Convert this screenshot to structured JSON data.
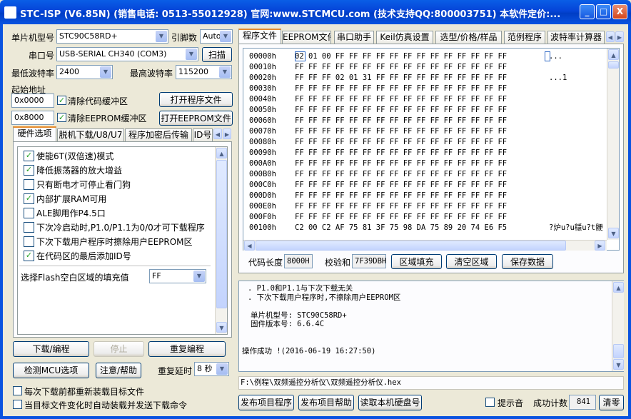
{
  "window": {
    "title": "STC-ISP (V6.85N) (销售电话: 0513-55012928) 官网:www.STCMCU.com (技术支持QQ:800003751) 本软件定价:...",
    "min_label": "_",
    "max_label": "□",
    "close_label": "X"
  },
  "left": {
    "mcu_label": "单片机型号",
    "mcu_value": "STC90C58RD+",
    "pins_label": "引脚数",
    "pins_value": "Auto",
    "port_label": "串口号",
    "port_value": "USB-SERIAL CH340 (COM3)",
    "scan_button": "扫描",
    "min_baud_label": "最低波特率",
    "min_baud_value": "2400",
    "max_baud_label": "最高波特率",
    "max_baud_value": "115200",
    "start_addr_label": "起始地址",
    "addr1_value": "0x0000",
    "clear_code_label": "清除代码缓冲区",
    "open_program_button": "打开程序文件",
    "addr2_value": "0x8000",
    "clear_eeprom_label": "清除EEPROM缓冲区",
    "open_eeprom_button": "打开EEPROM文件"
  },
  "left_tabs": [
    "硬件选项",
    "脱机下载/U8/U7",
    "程序加密后传输",
    "ID号"
  ],
  "hw_options": [
    {
      "label": "使能6T(双倍速)模式",
      "checked": true
    },
    {
      "label": "降低振荡器的放大增益",
      "checked": true
    },
    {
      "label": "只有断电才可停止看门狗",
      "checked": false
    },
    {
      "label": "内部扩展RAM可用",
      "checked": true
    },
    {
      "label": "ALE脚用作P4.5口",
      "checked": false
    },
    {
      "label": "下次冷启动时,P1.0/P1.1为0/0才可下载程序",
      "checked": false
    },
    {
      "label": "下次下载用户程序时擦除用户EEPROM区",
      "checked": false
    },
    {
      "label": "在代码区的最后添加ID号",
      "checked": true
    }
  ],
  "fill_label": "选择Flash空白区域的填充值",
  "fill_value": "FF",
  "bottom_left": {
    "download_button": "下载/编程",
    "stop_button": "停止",
    "reprogram_button": "重复编程",
    "detect_button": "检测MCU选项",
    "help_button": "注意/帮助",
    "repeat_delay_label": "重复延时",
    "repeat_delay_value": "8 秒",
    "reload_label": "每次下载前都重新装载目标文件",
    "auto_load_label": "当目标文件变化时自动装载并发送下载命令"
  },
  "right_tabs": [
    "程序文件",
    "EEPROM文件",
    "串口助手",
    "Keil仿真设置",
    "选型/价格/样品",
    "范例程序",
    "波特率计算器"
  ],
  "hex_rows": [
    {
      "addr": "00000h",
      "bytes": "02 01 00 FF FF FF FF FF FF FF FF FF FF FF FF FF",
      "ascii": "..."
    },
    {
      "addr": "00010h",
      "bytes": "FF FF FF FF FF FF FF FF FF FF FF FF FF FF FF FF",
      "ascii": ""
    },
    {
      "addr": "00020h",
      "bytes": "FF FF FF 02 01 31 FF FF FF FF FF FF FF FF FF FF",
      "ascii": "...1"
    },
    {
      "addr": "00030h",
      "bytes": "FF FF FF FF FF FF FF FF FF FF FF FF FF FF FF FF",
      "ascii": ""
    },
    {
      "addr": "00040h",
      "bytes": "FF FF FF FF FF FF FF FF FF FF FF FF FF FF FF FF",
      "ascii": ""
    },
    {
      "addr": "00050h",
      "bytes": "FF FF FF FF FF FF FF FF FF FF FF FF FF FF FF FF",
      "ascii": ""
    },
    {
      "addr": "00060h",
      "bytes": "FF FF FF FF FF FF FF FF FF FF FF FF FF FF FF FF",
      "ascii": ""
    },
    {
      "addr": "00070h",
      "bytes": "FF FF FF FF FF FF FF FF FF FF FF FF FF FF FF FF",
      "ascii": ""
    },
    {
      "addr": "00080h",
      "bytes": "FF FF FF FF FF FF FF FF FF FF FF FF FF FF FF FF",
      "ascii": ""
    },
    {
      "addr": "00090h",
      "bytes": "FF FF FF FF FF FF FF FF FF FF FF FF FF FF FF FF",
      "ascii": ""
    },
    {
      "addr": "000A0h",
      "bytes": "FF FF FF FF FF FF FF FF FF FF FF FF FF FF FF FF",
      "ascii": ""
    },
    {
      "addr": "000B0h",
      "bytes": "FF FF FF FF FF FF FF FF FF FF FF FF FF FF FF FF",
      "ascii": ""
    },
    {
      "addr": "000C0h",
      "bytes": "FF FF FF FF FF FF FF FF FF FF FF FF FF FF FF FF",
      "ascii": ""
    },
    {
      "addr": "000D0h",
      "bytes": "FF FF FF FF FF FF FF FF FF FF FF FF FF FF FF FF",
      "ascii": ""
    },
    {
      "addr": "000E0h",
      "bytes": "FF FF FF FF FF FF FF FF FF FF FF FF FF FF FF FF",
      "ascii": ""
    },
    {
      "addr": "000F0h",
      "bytes": "FF FF FF FF FF FF FF FF FF FF FF FF FF FF FF FF",
      "ascii": ""
    },
    {
      "addr": "00100h",
      "bytes": "C2 00 C2 AF 75 81 3F 75 98 DA 75 89 20 74 E6 F5",
      "ascii": "?炉u?u穩u?t骾"
    }
  ],
  "code_info": {
    "length_label": "代码长度",
    "length_value": "8000H",
    "checksum_label": "校验和",
    "checksum_value": "7F39DBH",
    "fill_button": "区域填充",
    "clear_button": "清空区域",
    "save_button": "保存数据"
  },
  "log_lines": [
    ". P1.0和P1.1与下次下载无关",
    ". 下次下载用户程序时,不擦除用户EEPROM区",
    "",
    "单片机型号: STC90C58RD+",
    "固件版本号: 6.6.4C",
    "",
    "",
    "操作成功 !(2016-06-19 16:27:50)"
  ],
  "file_path": "F:\\例程\\双频遥控分析仪\\双频遥控分析仪.hex",
  "bottom_right": {
    "publish_button": "发布项目程序",
    "publish_help_button": "发布项目帮助",
    "read_disk_button": "读取本机硬盘号",
    "beep_label": "提示音",
    "success_label": "成功计数",
    "success_value": "841",
    "clear_button": "清零"
  }
}
